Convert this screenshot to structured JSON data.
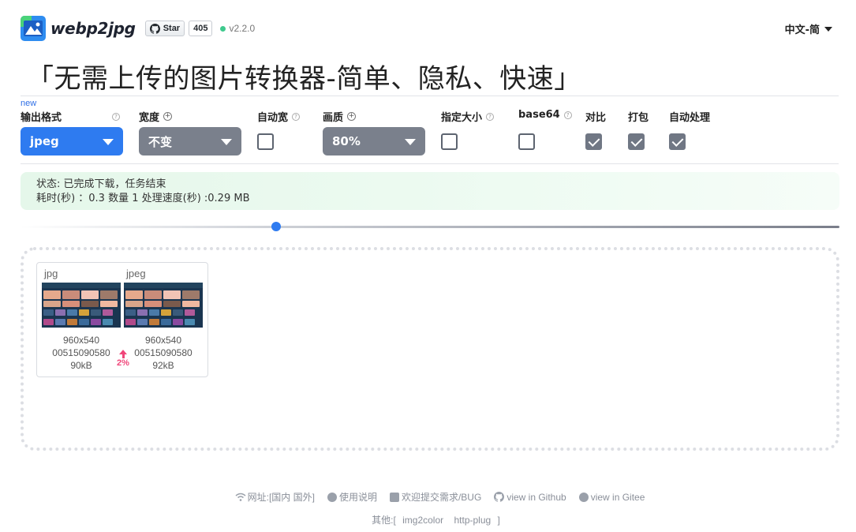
{
  "header": {
    "app_name": "webp2jpg",
    "github_star_label": "Star",
    "github_star_count": "405",
    "version": "v2.2.0",
    "language": "中文-简"
  },
  "title": "「无需上传的图片转换器-简单、隐私、快速」",
  "options": {
    "new_tag": "new",
    "output_format": {
      "label": "输出格式",
      "value": "jpeg"
    },
    "width": {
      "label": "宽度",
      "value": "不变"
    },
    "auto_width": {
      "label": "自动宽",
      "checked": false
    },
    "quality": {
      "label": "画质",
      "value": "80%"
    },
    "target_size": {
      "label": "指定大小",
      "checked": false
    },
    "base64": {
      "label": "base64",
      "checked": false
    },
    "compare": {
      "label": "对比",
      "checked": true
    },
    "pack": {
      "label": "打包",
      "checked": true
    },
    "auto_process": {
      "label": "自动处理",
      "checked": true
    }
  },
  "status": {
    "line1": "状态: 已完成下载，任务结束",
    "line2": "耗时(秒) ：0.3 数量 1 处理速度(秒) :0.29 MB"
  },
  "slider": {
    "value_fraction": 0.31
  },
  "result": {
    "original": {
      "format": "jpg",
      "dimensions": "960x540",
      "name": "00515090580",
      "size": "90kB"
    },
    "converted": {
      "format": "jpeg",
      "dimensions": "960x540",
      "name": "00515090580",
      "size": "92kB"
    },
    "change": "2%"
  },
  "footer": {
    "site": "网址:[国内 国外]",
    "help": "使用说明",
    "feedback": "欢迎提交需求/BUG",
    "github": "view in Github",
    "gitee": "view in Gitee",
    "others_prefix": "其他:[",
    "other1": "img2color",
    "other2": "http-plug",
    "others_suffix": "]"
  },
  "colors": {
    "accent_blue": "#2e7bf0",
    "select_gray": "#7a808c",
    "status_bg": "#e5f7ea",
    "delta_pink": "#f0467a",
    "version_dot": "#3ec98d"
  }
}
